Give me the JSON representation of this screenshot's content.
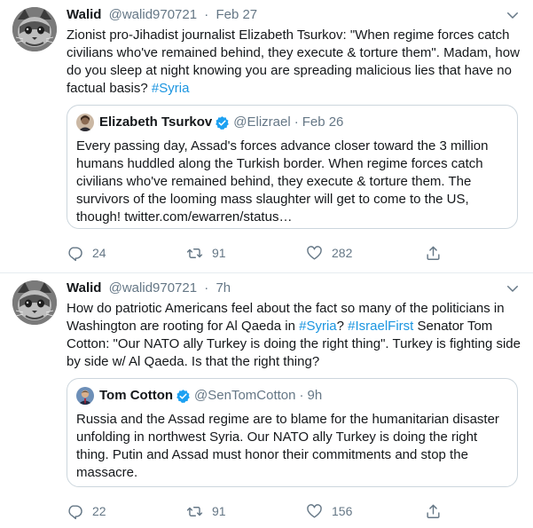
{
  "tweets": [
    {
      "name": "Walid",
      "handle": "@walid970721",
      "separator": "·",
      "time": "Feb 27",
      "text_before": "Zionist pro-Jihadist journalist Elizabeth Tsurkov: \"When regime forces catch civilians who've remained behind, they execute & torture them\". Madam, how do you sleep at night knowing you are spreading malicious lies that have no factual basis? ",
      "hashtag": "#Syria",
      "quote": {
        "name": "Elizabeth Tsurkov",
        "handle": "@Elizrael",
        "separator": "·",
        "time": "Feb 26",
        "text": "Every passing day, Assad's forces advance closer toward the 3 million humans huddled along the Turkish border. When regime forces catch civilians who've remained behind, they execute & torture them. The survivors of the looming mass slaughter will get to come to the US, though! twitter.com/ewarren/status…"
      },
      "replies": "24",
      "retweets": "91",
      "likes": "282"
    },
    {
      "name": "Walid",
      "handle": "@walid970721",
      "separator": "·",
      "time": "7h",
      "text_a": "How do patriotic Americans feel about the fact so many of the politicians in Washington are rooting for Al Qaeda in ",
      "hashtag_a": "#Syria",
      "text_b": "? ",
      "hashtag_b": "#IsraelFirst",
      "text_c": " Senator Tom Cotton: \"Our NATO ally Turkey is doing the right thing\". Turkey is fighting side by side w/ Al Qaeda. Is that the right thing?",
      "quote": {
        "name": "Tom Cotton",
        "handle": "@SenTomCotton",
        "separator": "·",
        "time": "9h",
        "text": "Russia and the Assad regime are to blame for the humanitarian disaster unfolding in northwest Syria. Our NATO ally Turkey is doing the right thing. Putin and Assad must honor their commitments and stop the massacre."
      },
      "replies": "22",
      "retweets": "91",
      "likes": "156"
    }
  ],
  "icons": {
    "reply": "reply-icon",
    "retweet": "retweet-icon",
    "like": "like-icon",
    "share": "share-icon",
    "caret": "chevron-down-icon",
    "verified": "verified-badge-icon"
  },
  "colors": {
    "link": "#1b95e0",
    "verified": "#1da1f2",
    "muted": "#657786",
    "border": "#ccd6dd"
  }
}
